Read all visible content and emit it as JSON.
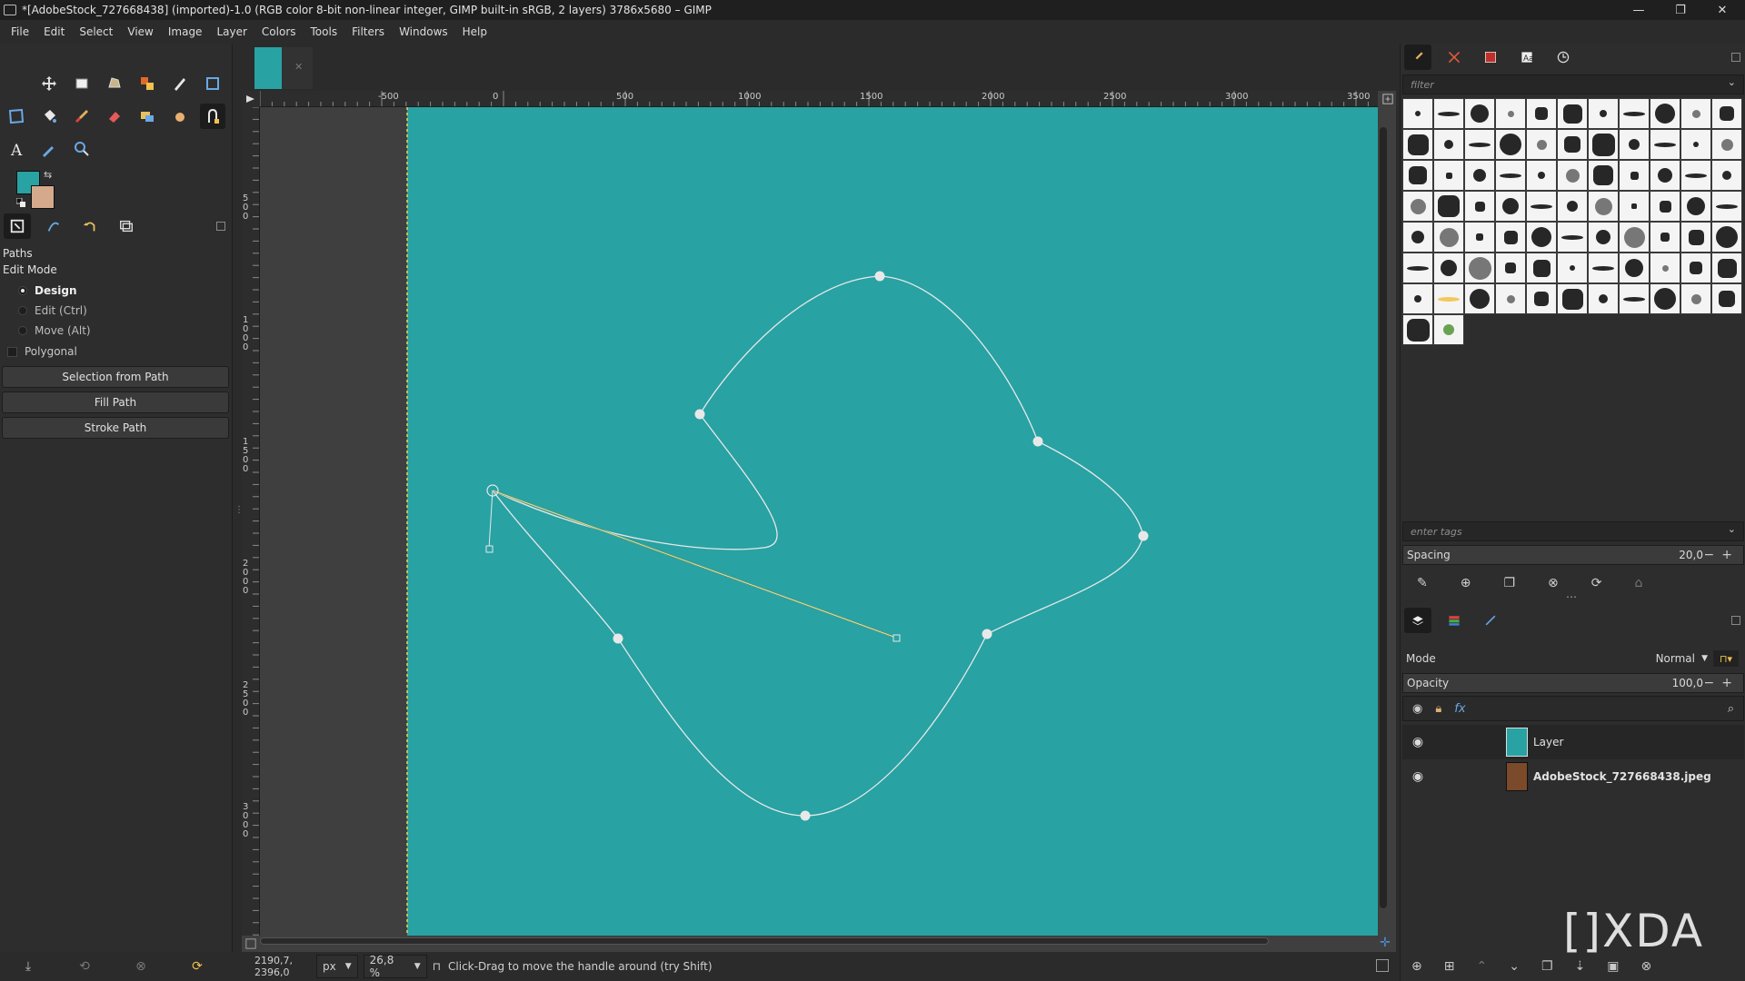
{
  "window": {
    "title": "*[AdobeStock_727668438] (imported)-1.0 (RGB color 8-bit non-linear integer, GIMP built-in sRGB, 2 layers) 3786x5680 – GIMP",
    "minimize": "—",
    "maximize": "❐",
    "close": "✕"
  },
  "menu": [
    "File",
    "Edit",
    "Select",
    "View",
    "Image",
    "Layer",
    "Colors",
    "Tools",
    "Filters",
    "Windows",
    "Help"
  ],
  "colors": {
    "foreground": "#28a2a3",
    "background": "#d4a98c",
    "canvas": "#28a2a3",
    "path": "#e8e8e8"
  },
  "tool_options": {
    "title": "Paths",
    "mode_label": "Edit Mode",
    "modes": [
      {
        "label": "Design",
        "selected": true
      },
      {
        "label": "Edit (Ctrl)",
        "selected": false
      },
      {
        "label": "Move (Alt)",
        "selected": false
      }
    ],
    "polygonal": "Polygonal",
    "buttons": [
      "Selection from Path",
      "Fill Path",
      "Stroke Path"
    ]
  },
  "ruler": {
    "top": [
      "-500",
      "0",
      "500",
      "1000",
      "1500",
      "2000",
      "2500",
      "3000",
      "3500"
    ],
    "left": [
      "500",
      "1000",
      "1500",
      "2000",
      "2500",
      "3000"
    ]
  },
  "status": {
    "coords": "2190,7, 2396,0",
    "unit": "px",
    "zoom": "26,8 %",
    "message": "Click-Drag to move the handle around (try Shift)"
  },
  "brushes": {
    "filter_placeholder": "filter",
    "tags_placeholder": "enter tags",
    "spacing_label": "Spacing",
    "spacing_value": "20,0"
  },
  "layers": {
    "mode_label": "Mode",
    "mode_value": "Normal",
    "opacity_label": "Opacity",
    "opacity_value": "100,0",
    "items": [
      {
        "name": "Layer",
        "bold": false
      },
      {
        "name": "AdobeStock_727668438.jpeg",
        "bold": true
      }
    ]
  },
  "watermark": "[]XDA"
}
